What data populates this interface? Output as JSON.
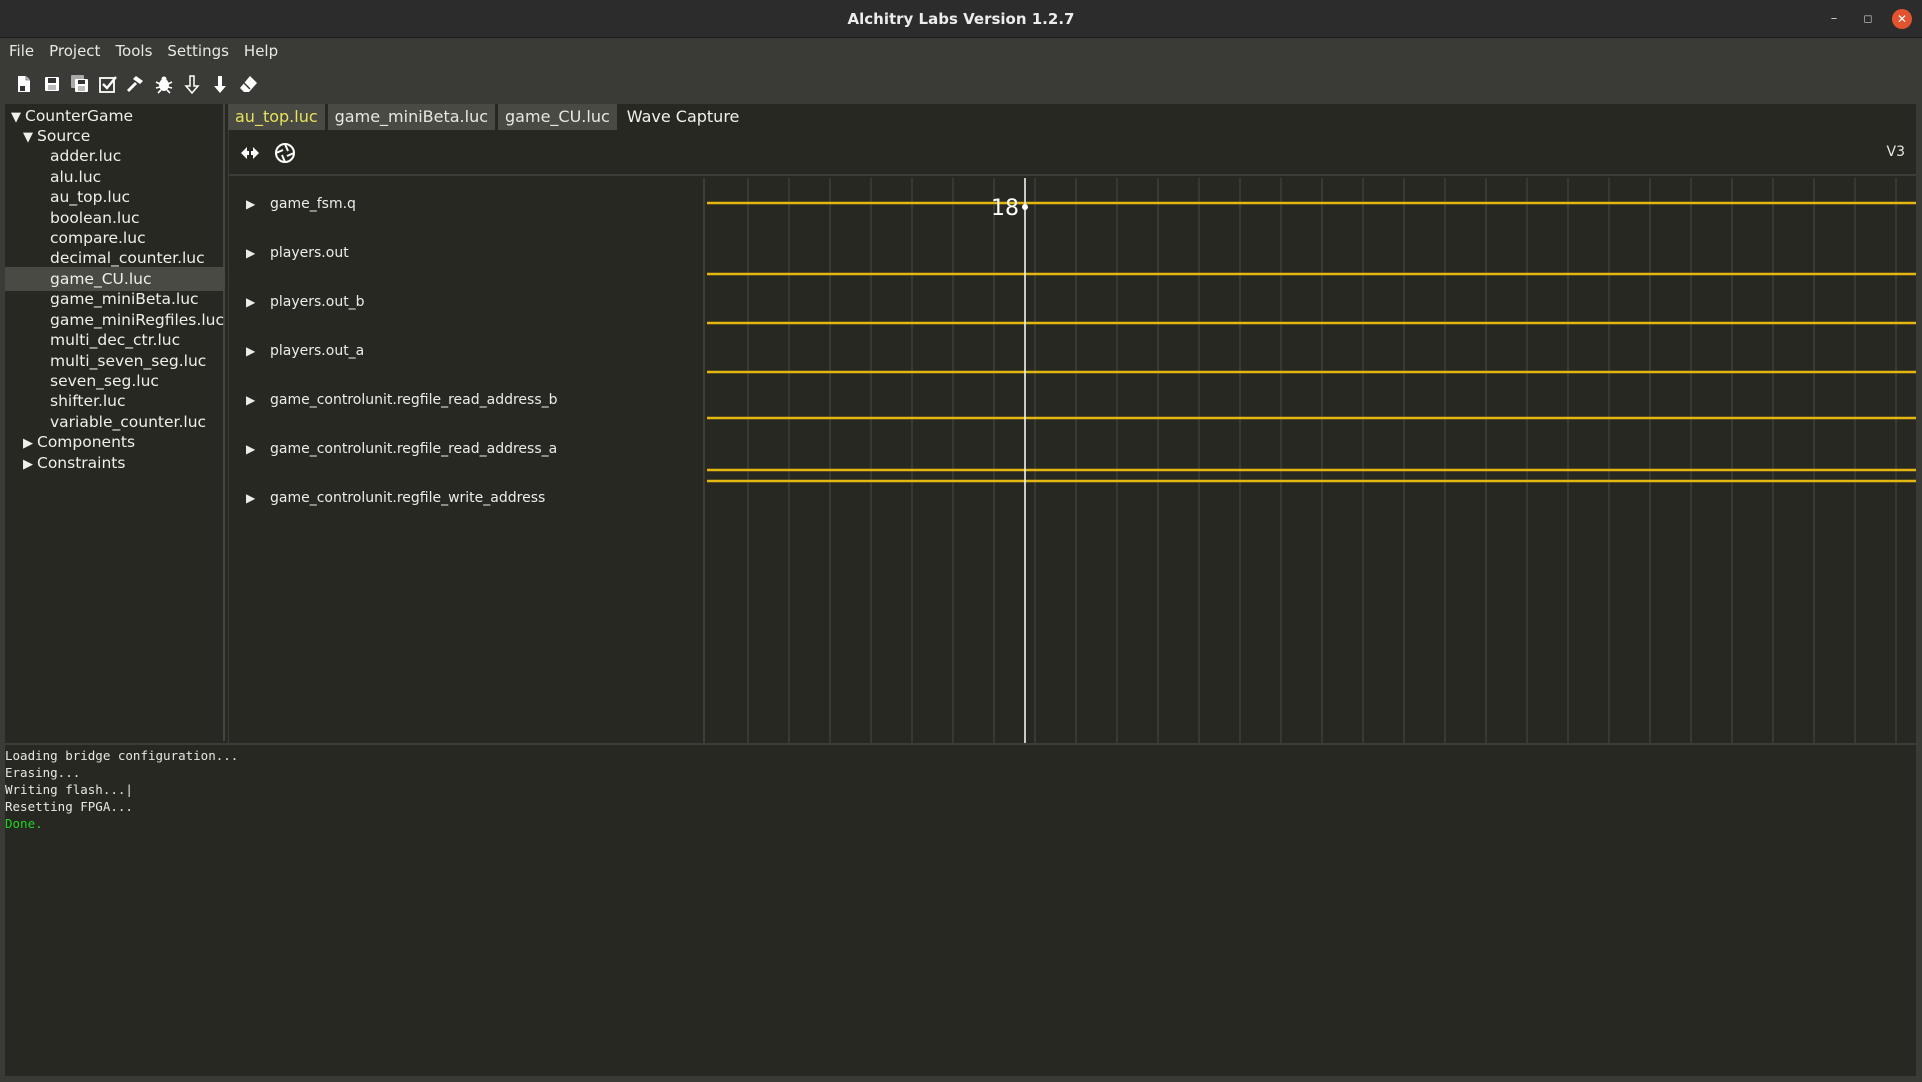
{
  "window": {
    "title": "Alchitry Labs Version 1.2.7",
    "minimize_glyph": "–",
    "maximize_glyph": "◻",
    "close_glyph": "✕"
  },
  "menu": [
    "File",
    "Project",
    "Tools",
    "Settings",
    "Help"
  ],
  "toolbar": {
    "icons": [
      "new-file-icon",
      "save-icon",
      "save-all-icon",
      "check-icon",
      "build-hammer-icon",
      "debug-bug-icon",
      "load-ram-arrow-icon",
      "load-flash-arrow-icon",
      "erase-eraser-icon"
    ]
  },
  "tree": {
    "project": "CounterGame",
    "source_label": "Source",
    "files": [
      "adder.luc",
      "alu.luc",
      "au_top.luc",
      "boolean.luc",
      "compare.luc",
      "decimal_counter.luc",
      "game_CU.luc",
      "game_miniBeta.luc",
      "game_miniRegfiles.luc",
      "multi_dec_ctr.luc",
      "multi_seven_seg.luc",
      "seven_seg.luc",
      "shifter.luc",
      "variable_counter.luc"
    ],
    "selected_file": "game_CU.luc",
    "components_label": "Components",
    "constraints_label": "Constraints"
  },
  "tabs": [
    {
      "label": "au_top.luc",
      "state": "modified"
    },
    {
      "label": "game_miniBeta.luc",
      "state": "normal"
    },
    {
      "label": "game_CU.luc",
      "state": "normal"
    },
    {
      "label": "Wave Capture",
      "state": "active"
    }
  ],
  "wave": {
    "version": "V3",
    "toolbar_icons": [
      "arm-trigger-icon",
      "capture-shutter-icon"
    ],
    "signals": [
      "game_fsm.q",
      "players.out",
      "players.out_b",
      "players.out_a",
      "game_controlunit.regfile_read_address_b",
      "game_controlunit.regfile_read_address_a",
      "game_controlunit.regfile_write_address"
    ],
    "cursor_value": "18",
    "trace_color": "#e5b60f",
    "cursor_color": "#ffffff",
    "grid_color": "#4a4a44"
  },
  "console": {
    "lines": [
      {
        "text": "Loading bridge configuration...",
        "status": "normal"
      },
      {
        "text": "Erasing...",
        "status": "normal"
      },
      {
        "text": "Writing flash...|",
        "status": "normal"
      },
      {
        "text": "Resetting FPGA...",
        "status": "normal"
      },
      {
        "text": "Done.",
        "status": "success"
      }
    ]
  }
}
